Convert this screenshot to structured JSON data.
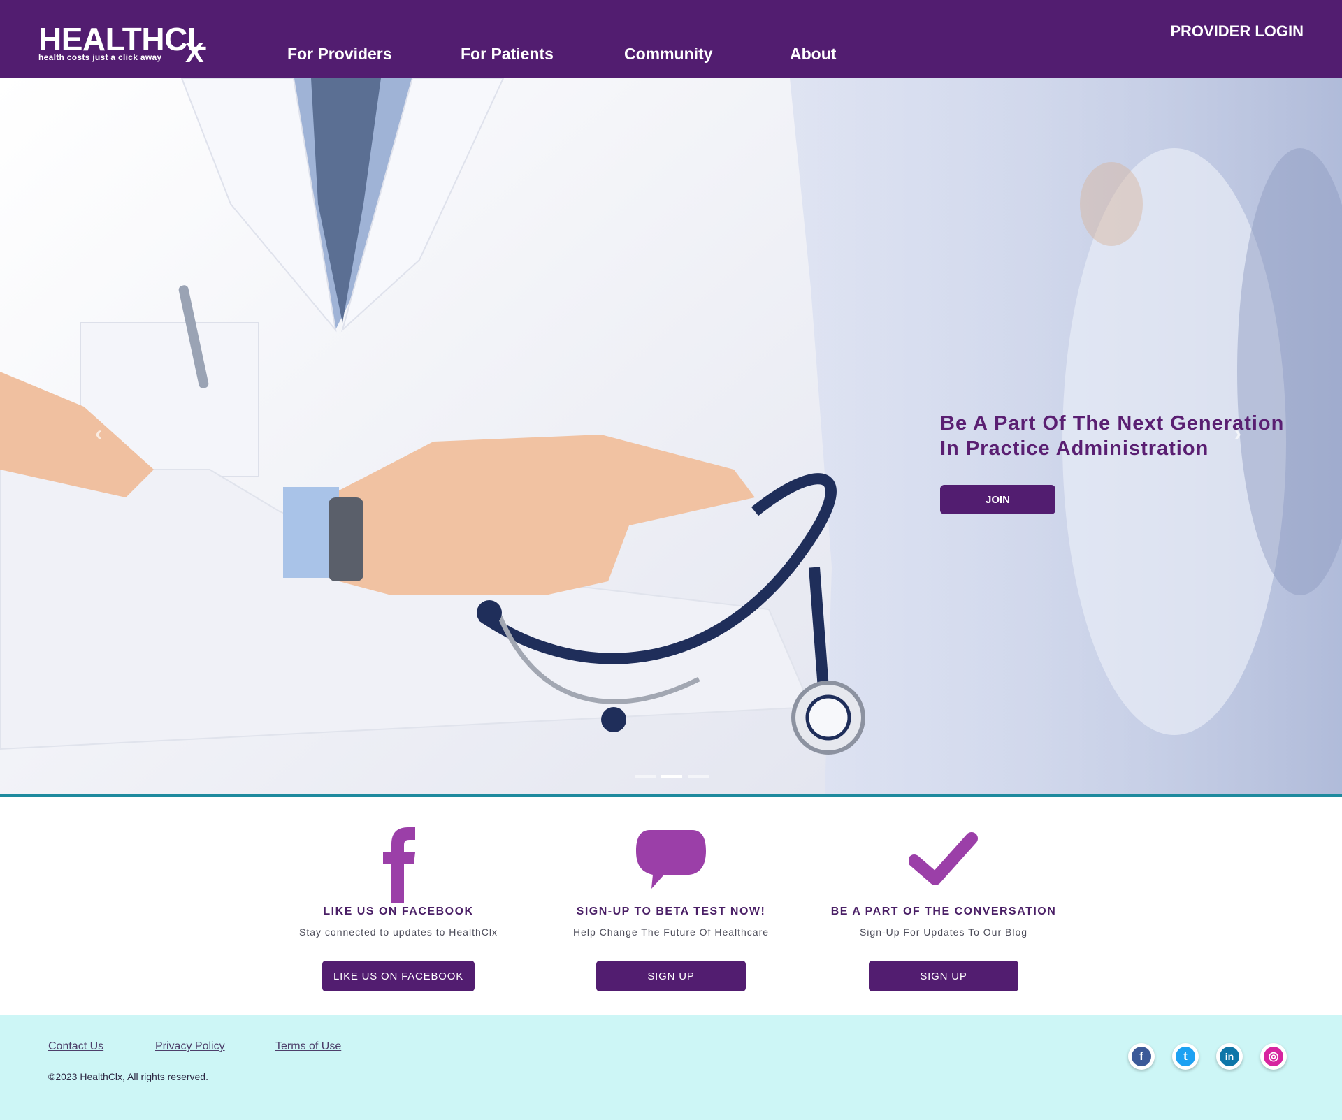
{
  "header": {
    "logo_text": "HEALTHCL",
    "logo_x": "X",
    "logo_tagline": "health costs just a click away",
    "nav": [
      "For Providers",
      "For Patients",
      "Community",
      "About"
    ],
    "provider_login": "PROVIDER LOGIN"
  },
  "hero": {
    "headline_line1": "Be A Part Of The Next Generation",
    "headline_line2": "In Practice Administration",
    "join_label": "JOIN",
    "prev_arrow": "‹",
    "next_arrow": "›",
    "slide_count": 3,
    "active_slide": 2
  },
  "features": [
    {
      "icon": "facebook-icon",
      "title": "LIKE US ON FACEBOOK",
      "subtitle": "Stay connected to updates to HealthClx",
      "button": "LIKE US ON FACEBOOK"
    },
    {
      "icon": "speech-bubble-icon",
      "title": "SIGN-UP TO BETA TEST NOW!",
      "subtitle": "Help Change The Future Of Healthcare",
      "button": "SIGN UP"
    },
    {
      "icon": "checkmark-icon",
      "title": "BE A PART OF THE CONVERSATION",
      "subtitle": "Sign-Up For Updates To Our Blog",
      "button": "SIGN UP"
    }
  ],
  "footer": {
    "links": [
      "Contact Us",
      "Privacy Policy",
      "Terms of Use"
    ],
    "copyright": "©2023 HealthClx, All rights reserved.",
    "social": [
      {
        "name": "facebook-icon",
        "glyph": "f",
        "color": "#3b5998"
      },
      {
        "name": "twitter-icon",
        "glyph": "t",
        "color": "#1da1f2"
      },
      {
        "name": "linkedin-icon",
        "glyph": "in",
        "color": "#0e76a8"
      },
      {
        "name": "instagram-icon",
        "glyph": "◎",
        "color": "#d6249f"
      }
    ]
  },
  "colors": {
    "brand_purple": "#521d70",
    "icon_purple": "#9b3fa8",
    "accent_teal": "#1e8a9e",
    "footer_bg": "#cdf6f6"
  }
}
